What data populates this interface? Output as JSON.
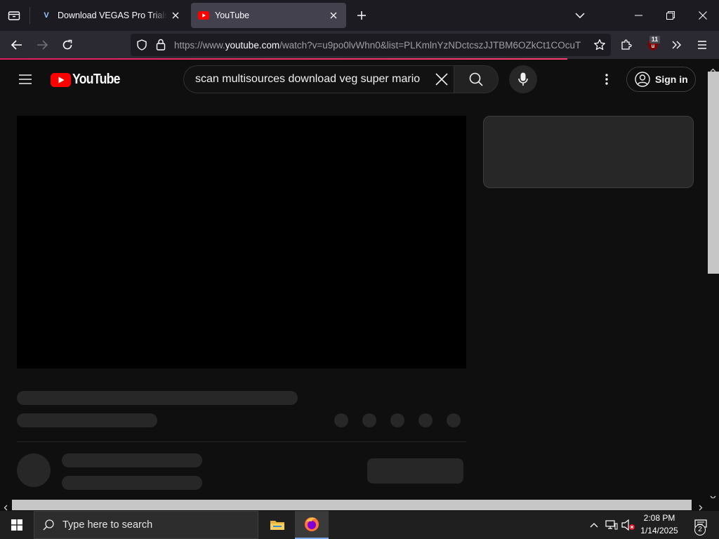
{
  "browser": {
    "tabs": [
      {
        "title": "Download VEGAS Pro Trials for Fr",
        "favicon": "vegas-v-icon",
        "favicon_letter": "V",
        "active": false
      },
      {
        "title": "YouTube",
        "favicon": "youtube-icon",
        "active": true
      }
    ],
    "url": {
      "prefix": "https://www.",
      "host": "youtube.com",
      "path": "/watch?v=u9po0lvWhn0&list=PLKmlnYzNDctcszJJTBM6OZkCt1COcuT"
    },
    "extension_badge": "11",
    "loading_color": "#e01e5a"
  },
  "youtube": {
    "logo_text": "YouTube",
    "search_value": "scan multisources download veg super mario",
    "sign_in_label": "Sign in",
    "brand_color": "#ff0000"
  },
  "taskbar": {
    "search_placeholder": "Type here to search",
    "time": "2:08 PM",
    "date": "1/14/2025",
    "notification_count": "2"
  }
}
